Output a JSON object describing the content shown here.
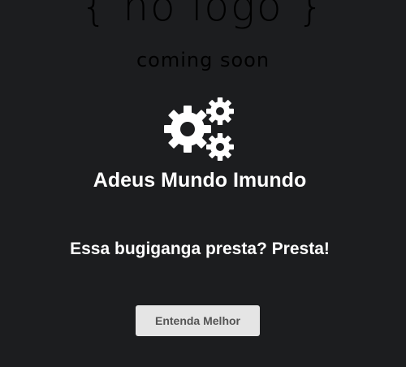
{
  "header": {
    "logo_text": "{ no logo }",
    "tagline": "coming soon"
  },
  "hero": {
    "icon": "gears-icon",
    "title": "Adeus Mundo Imundo",
    "subtitle": "Essa bugiganga presta? Presta!",
    "cta_label": "Entenda Melhor"
  },
  "colors": {
    "background": "#1c1d1f",
    "text": "#ffffff",
    "button_bg": "#e5e5e5",
    "button_text": "#555555"
  }
}
